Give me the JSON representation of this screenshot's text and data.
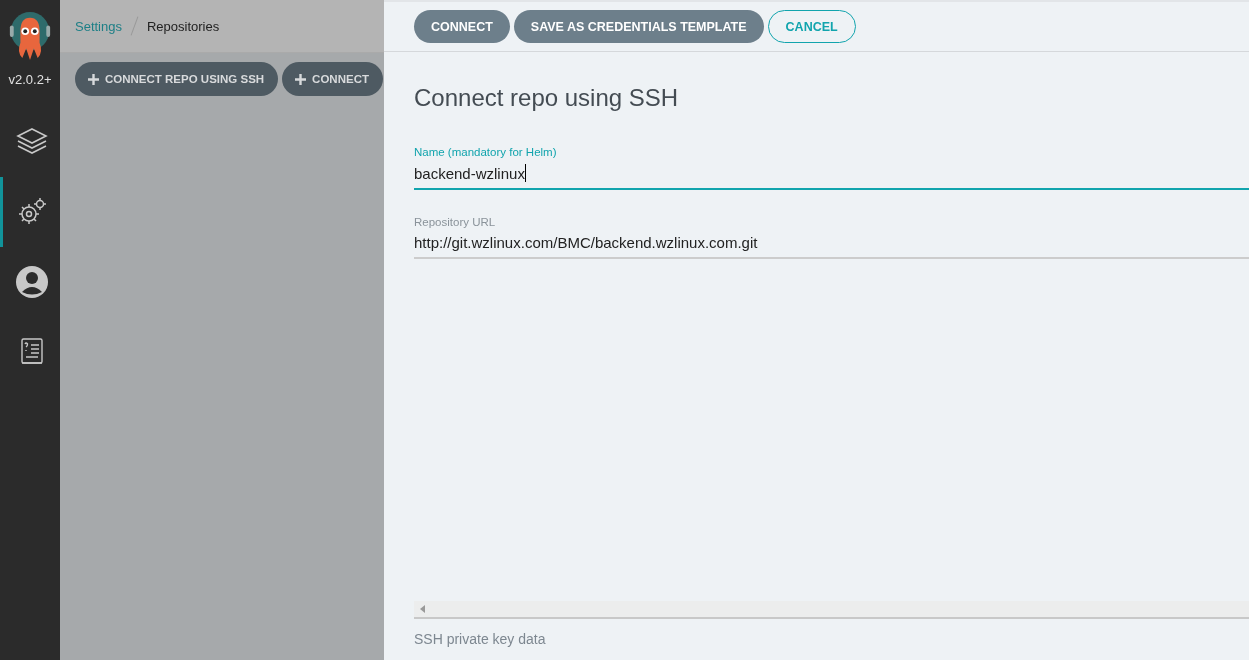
{
  "sidebar": {
    "version": "v2.0.2+",
    "items": [
      {
        "kind": "layers",
        "selected": false
      },
      {
        "kind": "gears",
        "selected": true
      },
      {
        "kind": "user",
        "selected": false
      },
      {
        "kind": "docs",
        "selected": false
      }
    ]
  },
  "breadcrumb": [
    {
      "label": "Settings",
      "kind": "link"
    },
    {
      "label": "Repositories",
      "kind": "current"
    }
  ],
  "toolbar_buttons": [
    {
      "label": "CONNECT REPO USING SSH"
    },
    {
      "label": "CONNECT"
    }
  ],
  "panel": {
    "buttons": [
      {
        "label": "CONNECT",
        "kind": "filled"
      },
      {
        "label": "SAVE AS CREDENTIALS TEMPLATE",
        "kind": "filled"
      },
      {
        "label": "CANCEL",
        "kind": "outlined"
      }
    ],
    "title": "Connect repo using SSH",
    "fields": [
      {
        "label": "Name (mandatory for Helm)",
        "value": "backend-wzlinux",
        "focused": true
      },
      {
        "label": "Repository URL",
        "value": "http://git.wzlinux.com/BMC/backend.wzlinux.com.git",
        "focused": false
      }
    ],
    "key_label": "SSH private key data"
  }
}
